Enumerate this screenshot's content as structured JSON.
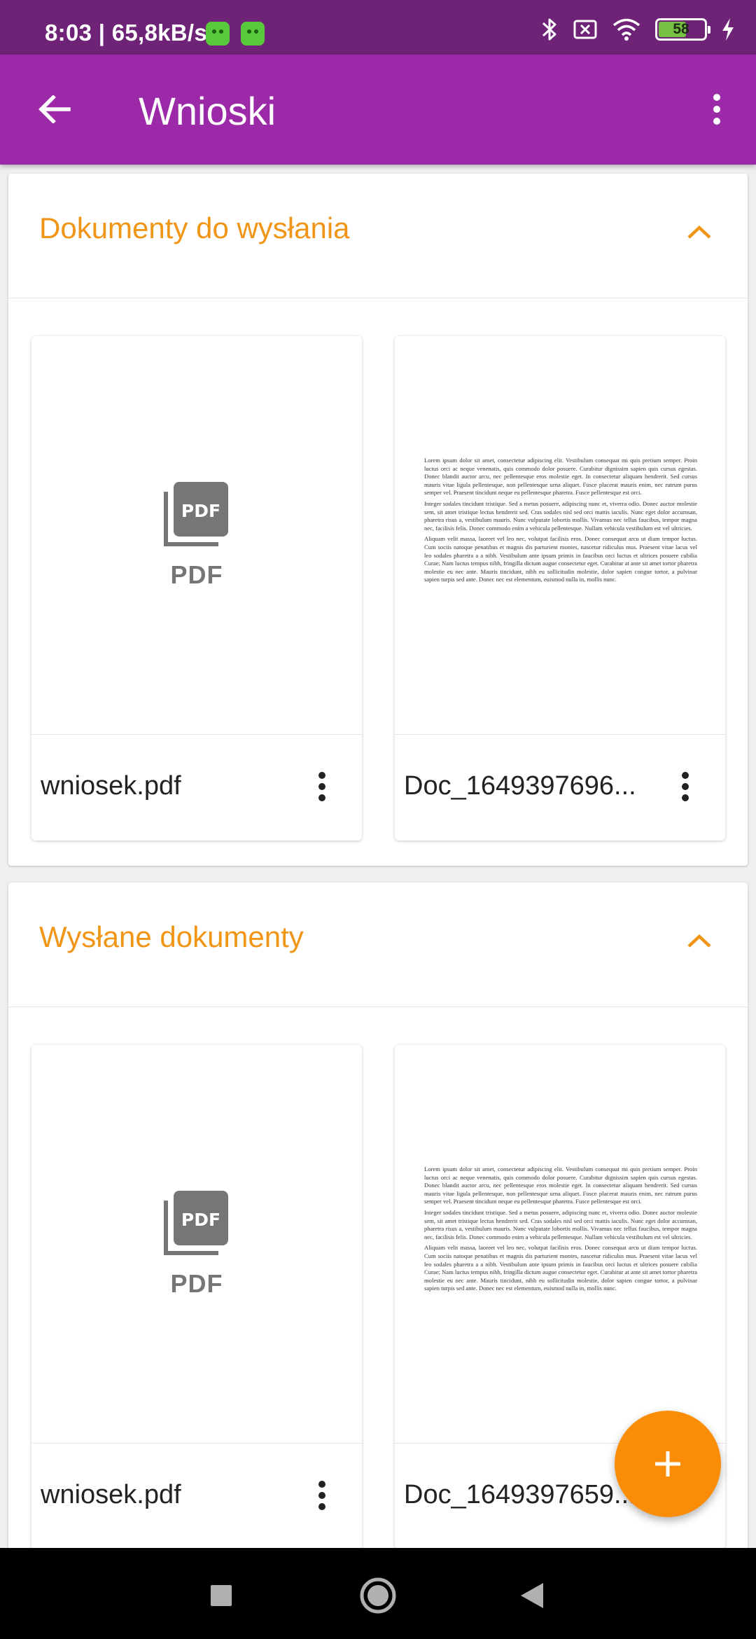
{
  "status_bar": {
    "time_speed": "8:03 | 65,8kB/s",
    "battery": "58",
    "battery_level": 0.58,
    "icons": [
      "app-notification-icon",
      "app-notification-icon",
      "bluetooth-icon",
      "no-sim-icon",
      "wifi-icon",
      "battery-icon",
      "charging-icon"
    ]
  },
  "app_bar": {
    "title": "Wnioski",
    "back_icon": "arrow-back-icon",
    "menu_icon": "more-vert-icon"
  },
  "sections": [
    {
      "title": "Dokumenty do wysłania",
      "expanded": true,
      "documents": [
        {
          "name": "wniosek.pdf",
          "thumbnail": "pdf-icon",
          "thumb_label": "PDF"
        },
        {
          "name": "Doc_1649397696...",
          "thumbnail": "page-preview"
        }
      ]
    },
    {
      "title": "Wysłane dokumenty",
      "expanded": true,
      "documents": [
        {
          "name": "wniosek.pdf",
          "thumbnail": "pdf-icon",
          "thumb_label": "PDF"
        },
        {
          "name": "Doc_1649397659...",
          "thumbnail": "page-preview"
        }
      ]
    }
  ],
  "preview_text": [
    "Lorem ipsum dolor sit amet, consectetur adipiscing elit. Vestibulum consequat mi quis pretium semper. Proin luctus orci ac neque venenatis, quis commodo dolor posuere. Curabitur dignissim sapien quis cursus egestas. Donec blandit auctor arcu, nec pellentesque eros molestie eget. In consectetur aliquam hendrerit. Sed cursus mauris vitae ligula pellentesque, non pellentesque urna aliquet. Fusce placerat mauris enim, nec rutrum purus semper vel. Praesent tincidunt neque eu pellentesque pharetra. Fusce pellentesque est orci.",
    "Integer sodales tincidunt tristique. Sed a metus posuere, adipiscing nunc et, viverra odio. Donec auctor molestie sem, sit amet tristique lectus hendrerit sed. Cras sodales nisl sed orci mattis iaculis. Nunc eget dolor accumsan, pharetra risus a, vestibulum mauris. Nunc vulputate lobortis mollis. Vivamus nec tellus faucibus, tempor magna nec, facilisis felis. Donec commodo enim a vehicula pellentesque. Nullam vehicula vestibulum est vel ultricies.",
    "Aliquam velit massa, laoreet vel leo nec, volutpat facilisis eros. Donec consequat arcu ut diam tempor luctus. Cum sociis natoque penatibus et magnis dis parturient montes, nascetur ridiculus mus. Praesent vitae lacus vel leo sodales pharetra a a nibh. Vestibulum ante ipsum primis in faucibus orci luctus et ultrices posuere cubilia Curae; Nam luctus tempus nibh, fringilla dictum augue consectetur eget. Curabitur at ante sit amet tortor pharetra molestie eu nec ante. Mauris tincidunt, nibh eu sollicitudin molestie, dolor sapien congue tortor, a pulvinar sapien turpis sed ante. Donec nec est elementum, euismod nulla in, mollis nunc."
  ],
  "fab": {
    "icon": "add-icon"
  },
  "nav_bar": {
    "icons": [
      "recents-square-icon",
      "home-circle-icon",
      "back-triangle-icon"
    ]
  },
  "colors": {
    "status_bar": "#6e2377",
    "app_bar": "#9b29a8",
    "accent_orange": "#f09516",
    "fab": "#fb8d06",
    "pdf_icon_gray": "#767676"
  }
}
